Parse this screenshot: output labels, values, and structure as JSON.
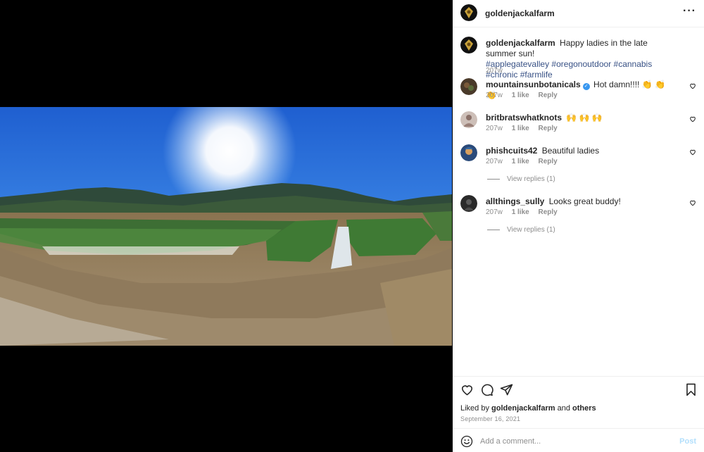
{
  "post": {
    "owner": "goldenjackalfarm",
    "more_icon": "more-horizontal-icon",
    "image_alt": "Panoramic view of a farm with rows of plants under a bright blue sky"
  },
  "caption": {
    "username": "goldenjackalfarm",
    "text": "Happy ladies in the late summer sun!",
    "hashtags": [
      "#applegatevalley",
      "#oregonoutdoor",
      "#cannabis",
      "#chronic",
      "#farmlife"
    ],
    "time": "207w"
  },
  "comments": [
    {
      "username": "mountainsunbotanicals",
      "verified": true,
      "text": "Hot damn!!!! 👏 👏 👏",
      "time": "207w",
      "likes": "1 like",
      "reply": "Reply",
      "view_replies": ""
    },
    {
      "username": "britbratswhatknots",
      "verified": false,
      "text": "🙌 🙌 🙌",
      "time": "207w",
      "likes": "1 like",
      "reply": "Reply",
      "view_replies": ""
    },
    {
      "username": "phishcuits42",
      "verified": false,
      "text": "Beautiful ladies",
      "time": "207w",
      "likes": "1 like",
      "reply": "Reply",
      "view_replies": "View replies (1)"
    },
    {
      "username": "allthings_sully",
      "verified": false,
      "text": "Looks great buddy!",
      "time": "207w",
      "likes": "1 like",
      "reply": "Reply",
      "view_replies": "View replies (1)"
    }
  ],
  "actions": {
    "like_icon": "heart-icon",
    "comment_icon": "comment-icon",
    "share_icon": "send-icon",
    "save_icon": "bookmark-icon"
  },
  "likes": {
    "prefix": "Liked by",
    "user": "goldenjackalfarm",
    "conjunction": "and",
    "others": "others"
  },
  "date": "September 16, 2021",
  "add_comment": {
    "placeholder": "Add a comment...",
    "post_label": "Post",
    "emoji_icon": "emoji-icon"
  },
  "colors": {
    "link": "#385185",
    "verified": "#3897f0",
    "post_disabled": "#b2dffc",
    "muted": "#8e8e8e"
  }
}
